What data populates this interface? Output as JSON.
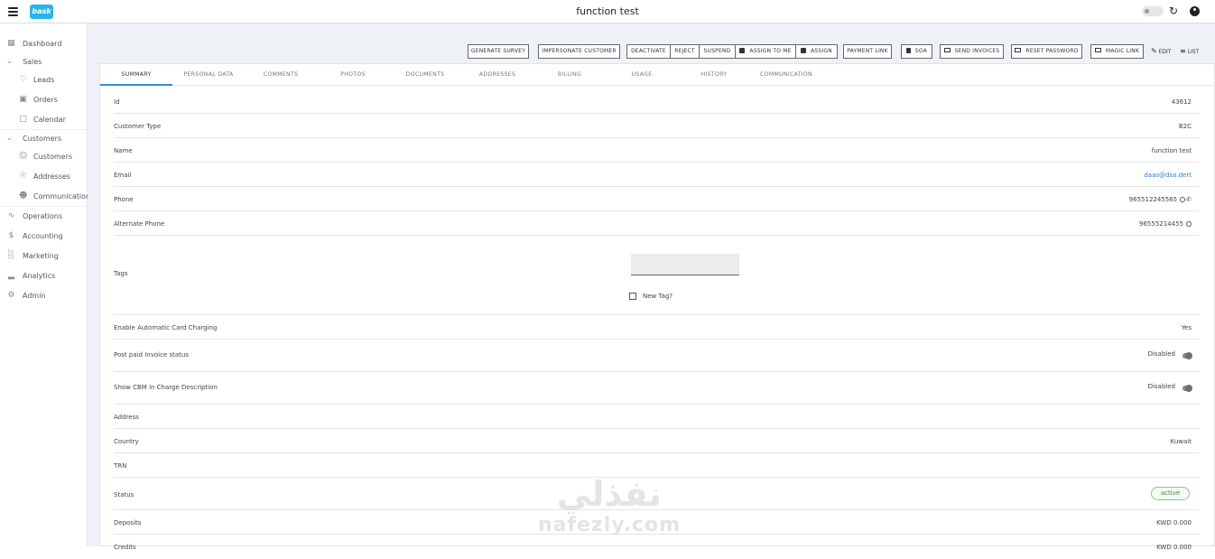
{
  "app": {
    "title": "function test",
    "logo_text": "bask"
  },
  "sidebar": {
    "items": [
      {
        "icon": "grid-icon",
        "label": "Dashboard"
      },
      {
        "icon": "chevron-down-icon",
        "label": "Sales"
      },
      {
        "icon": "heart-icon",
        "label": "Leads"
      },
      {
        "icon": "cart-icon",
        "label": "Orders"
      },
      {
        "icon": "calendar-icon",
        "label": "Calendar"
      },
      {
        "icon": "chevron-down-icon",
        "label": "Customers"
      },
      {
        "icon": "person-icon",
        "label": "Customers"
      },
      {
        "icon": "location-icon",
        "label": "Addresses"
      },
      {
        "icon": "people-icon",
        "label": "Communication"
      },
      {
        "icon": "pulse-icon",
        "label": "Operations"
      },
      {
        "icon": "dollar-icon",
        "label": "Accounting"
      },
      {
        "icon": "bar-chart-icon",
        "label": "Marketing"
      },
      {
        "icon": "analytics-icon",
        "label": "Analytics"
      },
      {
        "icon": "gear-icon",
        "label": "Admin"
      }
    ]
  },
  "toolbar": {
    "generate_survey": "GENERATE SURVEY",
    "impersonate": "IMPERSONATE CUSTOMER",
    "deactivate": "DEACTIVATE",
    "reject": "REJECT",
    "suspend": "SUSPEND",
    "assign_to_me": "ASSIGN TO ME",
    "assign": "ASSIGN",
    "payment_link": "PAYMENT LINK",
    "soa": "SOA",
    "send_invoices": "SEND INVOICES",
    "reset_password": "RESET PASSWORD",
    "magic_link": "MAGIC LINK",
    "edit": "EDIT",
    "list": "LIST"
  },
  "tabs": [
    "SUMMARY",
    "PERSONAL DATA",
    "COMMENTS",
    "PHOTOS",
    "DOCUMENTS",
    "ADDRESSES",
    "BILLING",
    "USAGE",
    "HISTORY",
    "COMMUNICATION"
  ],
  "summary": {
    "id": {
      "label": "Id",
      "value": "43612"
    },
    "customer_type": {
      "label": "Customer Type",
      "value": "B2C"
    },
    "name": {
      "label": "Name",
      "value": "function test"
    },
    "email": {
      "label": "Email",
      "value": "daas@dsa.dert"
    },
    "phone": {
      "label": "Phone",
      "value": "965512245565"
    },
    "alt_phone": {
      "label": "Alternate Phone",
      "value": "96555214455"
    },
    "tags": {
      "label": "Tags",
      "new_tag_label": "New Tag?"
    },
    "auto_charge": {
      "label": "Enable Automatic Card Charging",
      "value": "Yes"
    },
    "postpaid": {
      "label": "Post paid Invoice status",
      "value": "Disabled",
      "on": false
    },
    "cbm": {
      "label": "Show CBM in Charge Description",
      "value": "Disabled",
      "on": false
    },
    "address": {
      "label": "Address",
      "value": ""
    },
    "country": {
      "label": "Country",
      "value": "Kuwait"
    },
    "trn": {
      "label": "TRN",
      "value": ""
    },
    "status": {
      "label": "Status",
      "value": "active"
    },
    "deposits": {
      "label": "Deposits",
      "value": "KWD 0.000"
    },
    "credits": {
      "label": "Credits",
      "value": "KWD 0.000"
    }
  },
  "watermark": {
    "arabic": "نفذلي",
    "latin": "nafezly.com"
  },
  "colors": {
    "accent": "#2f8fe0",
    "logo": "#2bb4e6",
    "status_active": "#3a8e39",
    "link": "#2f7fd1"
  }
}
